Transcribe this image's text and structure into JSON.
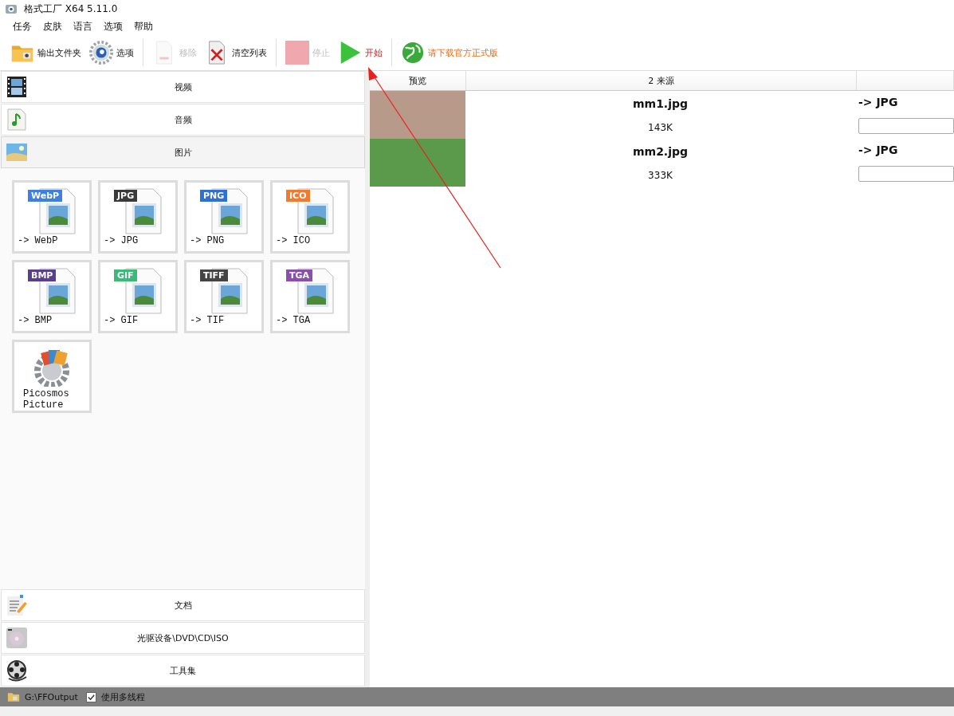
{
  "window": {
    "title": "格式工厂 X64 5.11.0"
  },
  "menu": [
    "任务",
    "皮肤",
    "语言",
    "选项",
    "帮助"
  ],
  "toolbar": [
    {
      "kind": "folder",
      "label": "输出文件夹",
      "disabled": false
    },
    {
      "kind": "options",
      "label": "选项",
      "disabled": false
    },
    {
      "kind": "remove",
      "label": "移除",
      "disabled": true
    },
    {
      "kind": "clear",
      "label": "清空列表",
      "disabled": false
    },
    {
      "kind": "stop",
      "label": "停止",
      "disabled": true
    },
    {
      "kind": "start",
      "label": "开始",
      "disabled": false
    },
    {
      "kind": "download",
      "label": "请下载官方正式版",
      "disabled": false
    }
  ],
  "categories_top": [
    {
      "kind": "video",
      "label": "视频",
      "expanded": false
    },
    {
      "kind": "audio",
      "label": "音频",
      "expanded": false
    },
    {
      "kind": "picture",
      "label": "图片",
      "expanded": true
    }
  ],
  "tiles": [
    {
      "kind": "format",
      "badge": "WebP",
      "label": "-> WebP",
      "color": "#3f7fe0"
    },
    {
      "kind": "format",
      "badge": "JPG",
      "label": "-> JPG",
      "color": "#3a3a3a"
    },
    {
      "kind": "format",
      "badge": "PNG",
      "label": "-> PNG",
      "color": "#2f6fd6"
    },
    {
      "kind": "format",
      "badge": "ICO",
      "label": "-> ICO",
      "color": "#f07a30"
    },
    {
      "kind": "format",
      "badge": "BMP",
      "label": "-> BMP",
      "color": "#5a3f8c"
    },
    {
      "kind": "format",
      "badge": "GIF",
      "label": "-> GIF",
      "color": "#3cb878"
    },
    {
      "kind": "format",
      "badge": "TIFF",
      "label": "-> TIF",
      "color": "#444444"
    },
    {
      "kind": "format",
      "badge": "TGA",
      "label": "-> TGA",
      "color": "#8a4fa8"
    },
    {
      "kind": "app",
      "label": "Picosmos Picture"
    }
  ],
  "categories_bottom": [
    {
      "kind": "document",
      "label": "文档",
      "expanded": false
    },
    {
      "kind": "disc",
      "label": "光驱设备\\DVD\\CD\\ISO",
      "expanded": false
    },
    {
      "kind": "tools",
      "label": "工具集",
      "expanded": false
    }
  ],
  "table": {
    "columns": [
      "预览",
      "2 来源"
    ],
    "rows": [
      {
        "name": "mm1.jpg",
        "size": "143K",
        "target": "-> JPG"
      },
      {
        "name": "mm2.jpg",
        "size": "333K",
        "target": "-> JPG"
      }
    ]
  },
  "status_bar": {
    "path": "G:\\FFOutput",
    "multithread": {
      "label": "使用多线程",
      "checked": true
    }
  }
}
